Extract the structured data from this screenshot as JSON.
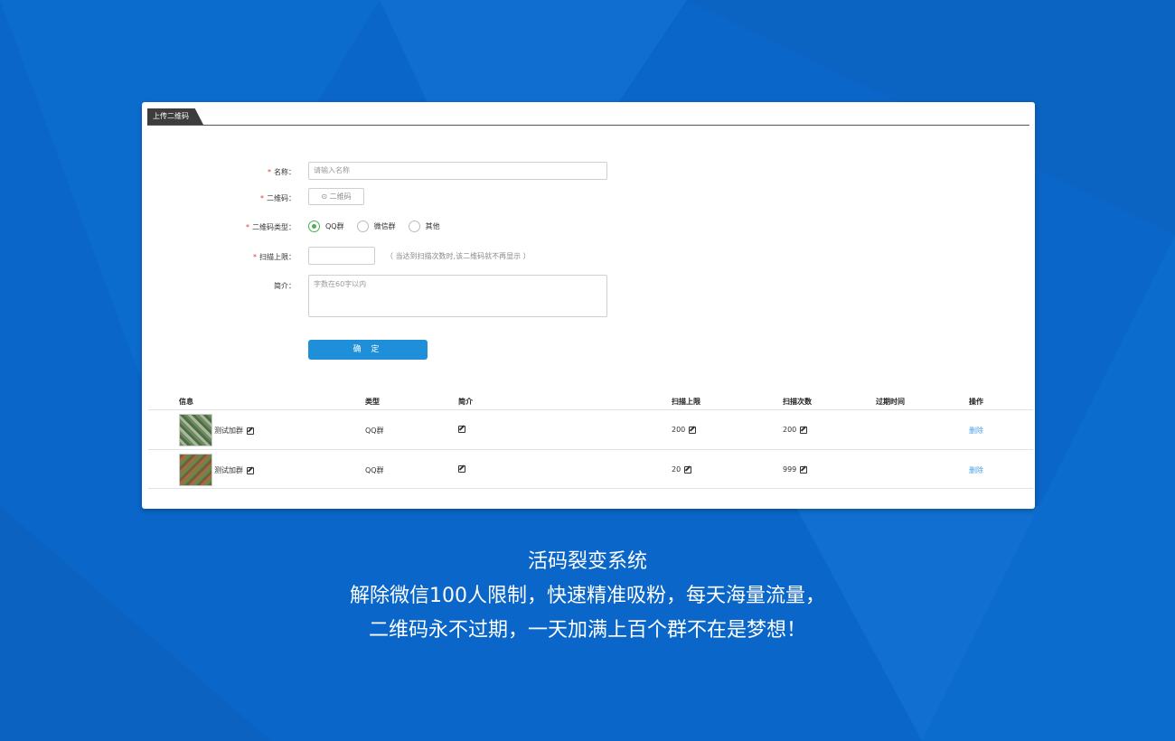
{
  "tab": {
    "label": "上传二维码"
  },
  "form": {
    "name_label": "名称：",
    "name_placeholder": "请输入名称",
    "qr_label": "二维码：",
    "qr_button": "⊙ 二维码",
    "type_label": "二维码类型：",
    "types": [
      "QQ群",
      "微信群",
      "其他"
    ],
    "selected_type": "QQ群",
    "limit_label": "扫描上限：",
    "limit_hint": "（ 当达到扫描次数时,该二维码就不再显示 ）",
    "intro_label": "简介：",
    "intro_placeholder": "字数在60字以内",
    "confirm": "确 定",
    "required_mark": "*"
  },
  "table": {
    "headers": [
      "信息",
      "类型",
      "简介",
      "扫描上限",
      "扫描次数",
      "过期时间",
      "操作"
    ],
    "rows": [
      {
        "name": "测试加群",
        "type": "QQ群",
        "limit": "200",
        "count": "200",
        "expire": "",
        "action": "删除"
      },
      {
        "name": "测试加群",
        "type": "QQ群",
        "limit": "20",
        "count": "999",
        "expire": "",
        "action": "删除"
      }
    ]
  },
  "caption": {
    "line1": "活码裂变系统",
    "line2": "解除微信100人限制，快速精准吸粉，每天海量流量，",
    "line3": "二维码永不过期，一天加满上百个群不在是梦想！"
  },
  "colors": {
    "background": "#0a66c8",
    "accent": "#1e8fd8",
    "check": "#4caf50",
    "required": "#e03b3b"
  }
}
